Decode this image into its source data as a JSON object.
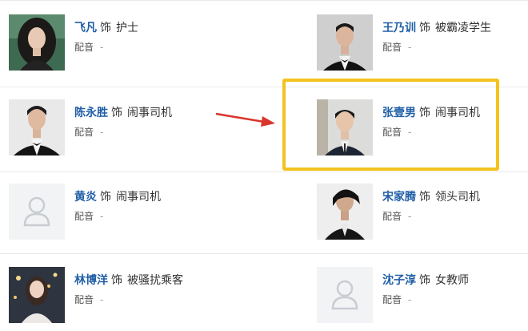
{
  "cast": [
    {
      "actor": "飞凡",
      "role_word": "饰",
      "role": "护士",
      "dub_label": "配音",
      "dub_value": "-",
      "avatar": "photo-woman-dark-hair"
    },
    {
      "actor": "王乃训",
      "role_word": "饰",
      "role": "被霸凌学生",
      "dub_label": "配音",
      "dub_value": "-",
      "avatar": "photo-man-tuxedo"
    },
    {
      "actor": "陈永胜",
      "role_word": "饰",
      "role": "闹事司机",
      "dub_label": "配音",
      "dub_value": "-",
      "avatar": "photo-man-tuxedo"
    },
    {
      "actor": "张壹男",
      "role_word": "饰",
      "role": "闹事司机",
      "dub_label": "配音",
      "dub_value": "-",
      "avatar": "photo-man-suit"
    },
    {
      "actor": "黄炎",
      "role_word": "饰",
      "role": "闹事司机",
      "dub_label": "配音",
      "dub_value": "-",
      "avatar": "placeholder-person-icon"
    },
    {
      "actor": "宋家腾",
      "role_word": "饰",
      "role": "领头司机",
      "dub_label": "配音",
      "dub_value": "-",
      "avatar": "photo-man-dark-jacket"
    },
    {
      "actor": "林博洋",
      "role_word": "饰",
      "role": "被骚扰乘客",
      "dub_label": "配音",
      "dub_value": "-",
      "avatar": "photo-woman-night"
    },
    {
      "actor": "沈子淳",
      "role_word": "饰",
      "role": "女教师",
      "dub_label": "配音",
      "dub_value": "-",
      "avatar": "placeholder-person-icon"
    }
  ],
  "colors": {
    "actor_link": "#1f5ea6",
    "highlight": "#f4c21e",
    "arrow": "#d9352b"
  }
}
